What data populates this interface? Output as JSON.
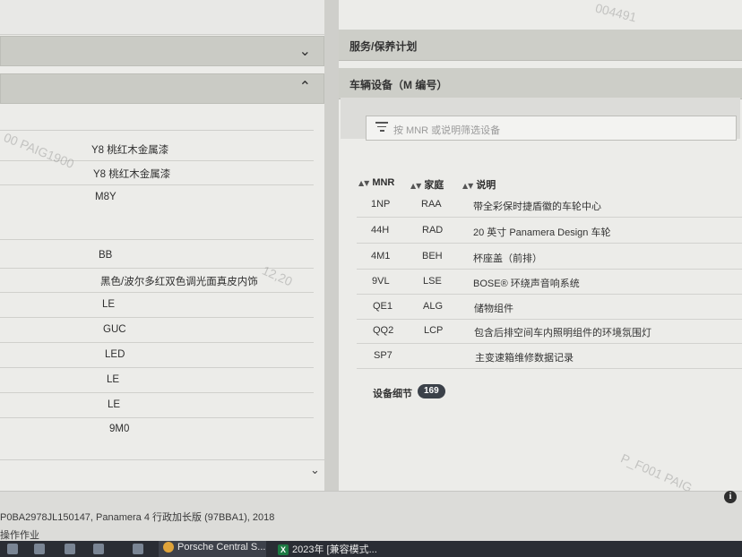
{
  "watermarks": [
    "004491",
    "00 PAIG1900",
    "1",
    "12,20",
    "P_F001 PAIG",
    "00"
  ],
  "left_panel": {
    "rows": [
      {
        "value": "Y8 桃红木金属漆"
      },
      {
        "value": "Y8 桃红木金属漆"
      },
      {
        "value": "M8Y"
      },
      {
        "value": ""
      },
      {
        "value": "BB"
      },
      {
        "value": "黑色/波尔多红双色调光面真皮内饰"
      },
      {
        "value": "LE"
      },
      {
        "value": "GUC"
      },
      {
        "value": "LED"
      },
      {
        "value": "LE"
      },
      {
        "value": "LE"
      },
      {
        "value": "9M0"
      }
    ],
    "icons": {
      "collapse_top": "chevron-down-icon",
      "collapse_open": "chevron-up-icon",
      "collapse_bottom": "chevron-down-icon"
    }
  },
  "right_panel": {
    "service_header": "服务/保养计划",
    "equipment_header": "车辆设备（M 编号）",
    "filter_placeholder": "按 MNR 或说明筛选设备",
    "columns": [
      "MNR",
      "家庭",
      "说明"
    ],
    "rows": [
      {
        "mnr": "1NP",
        "family": "RAA",
        "desc": "带全彩保时捷盾徽的车轮中心"
      },
      {
        "mnr": "44H",
        "family": "RAD",
        "desc": "20 英寸 Panamera Design 车轮"
      },
      {
        "mnr": "4M1",
        "family": "BEH",
        "desc": "杯座盖（前排）"
      },
      {
        "mnr": "9VL",
        "family": "LSE",
        "desc": "BOSE® 环绕声音响系统"
      },
      {
        "mnr": "QE1",
        "family": "ALG",
        "desc": "储物组件"
      },
      {
        "mnr": "QQ2",
        "family": "LCP",
        "desc": "包含后排空间车内照明组件的环境氛围灯"
      },
      {
        "mnr": "SP7",
        "family": "",
        "desc": "主变速箱维修数据记录"
      }
    ],
    "details_label": "设备细节",
    "details_count": "169"
  },
  "footer": {
    "vehicle": "P0BA2978JL150147, Panamera 4 行政加长版 (97BBA1), 2018",
    "operation": "操作作业"
  },
  "taskbar": {
    "apps": [
      {
        "label": "Porsche Central S...",
        "icon": "chrome-icon"
      },
      {
        "label": "2023年  [兼容模式...",
        "icon": "excel-icon"
      }
    ]
  }
}
